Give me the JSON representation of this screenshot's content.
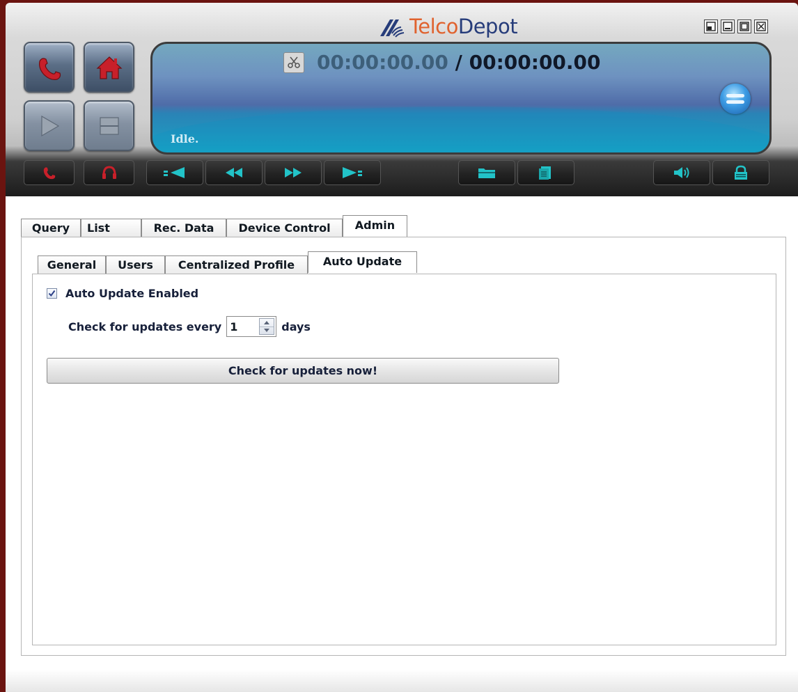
{
  "app": {
    "logo_word_1": "Telco",
    "logo_word_2": "Depot",
    "window_buttons": [
      "restore-small-icon",
      "minimize-icon",
      "maximize-icon",
      "close-icon"
    ]
  },
  "player": {
    "current_time": "00:00:00.00",
    "separator": "/",
    "total_time": "00:00:00.00",
    "status": "Idle.",
    "icons": {
      "left_big": [
        "phone-icon",
        "home-icon",
        "play-icon",
        "stop-icon"
      ],
      "transport": [
        "phone-small-icon",
        "headset-icon",
        "skip-back-icon",
        "rewind-icon",
        "fast-forward-icon",
        "skip-forward-icon",
        "folder-icon",
        "document-stack-icon",
        "volume-icon",
        "lock-icon"
      ]
    },
    "colors": {
      "display_top": "#6e92c0",
      "display_bottom": "#1aa2c4",
      "accent_cyan": "#22c3c8",
      "accent_red": "#c8202a"
    }
  },
  "main_tabs": [
    {
      "label": "Query"
    },
    {
      "label": "List"
    },
    {
      "label": "Rec. Data"
    },
    {
      "label": "Device Control"
    },
    {
      "label": "Admin",
      "active": true
    }
  ],
  "admin_tabs": [
    {
      "label": "General"
    },
    {
      "label": "Users"
    },
    {
      "label": "Centralized Profile"
    },
    {
      "label": "Auto Update",
      "active": true
    }
  ],
  "auto_update": {
    "enabled_label": "Auto Update Enabled",
    "enabled": true,
    "interval_label": "Check for updates every",
    "interval_value": "1",
    "interval_unit": "days",
    "check_now_label": "Check for updates now!"
  }
}
